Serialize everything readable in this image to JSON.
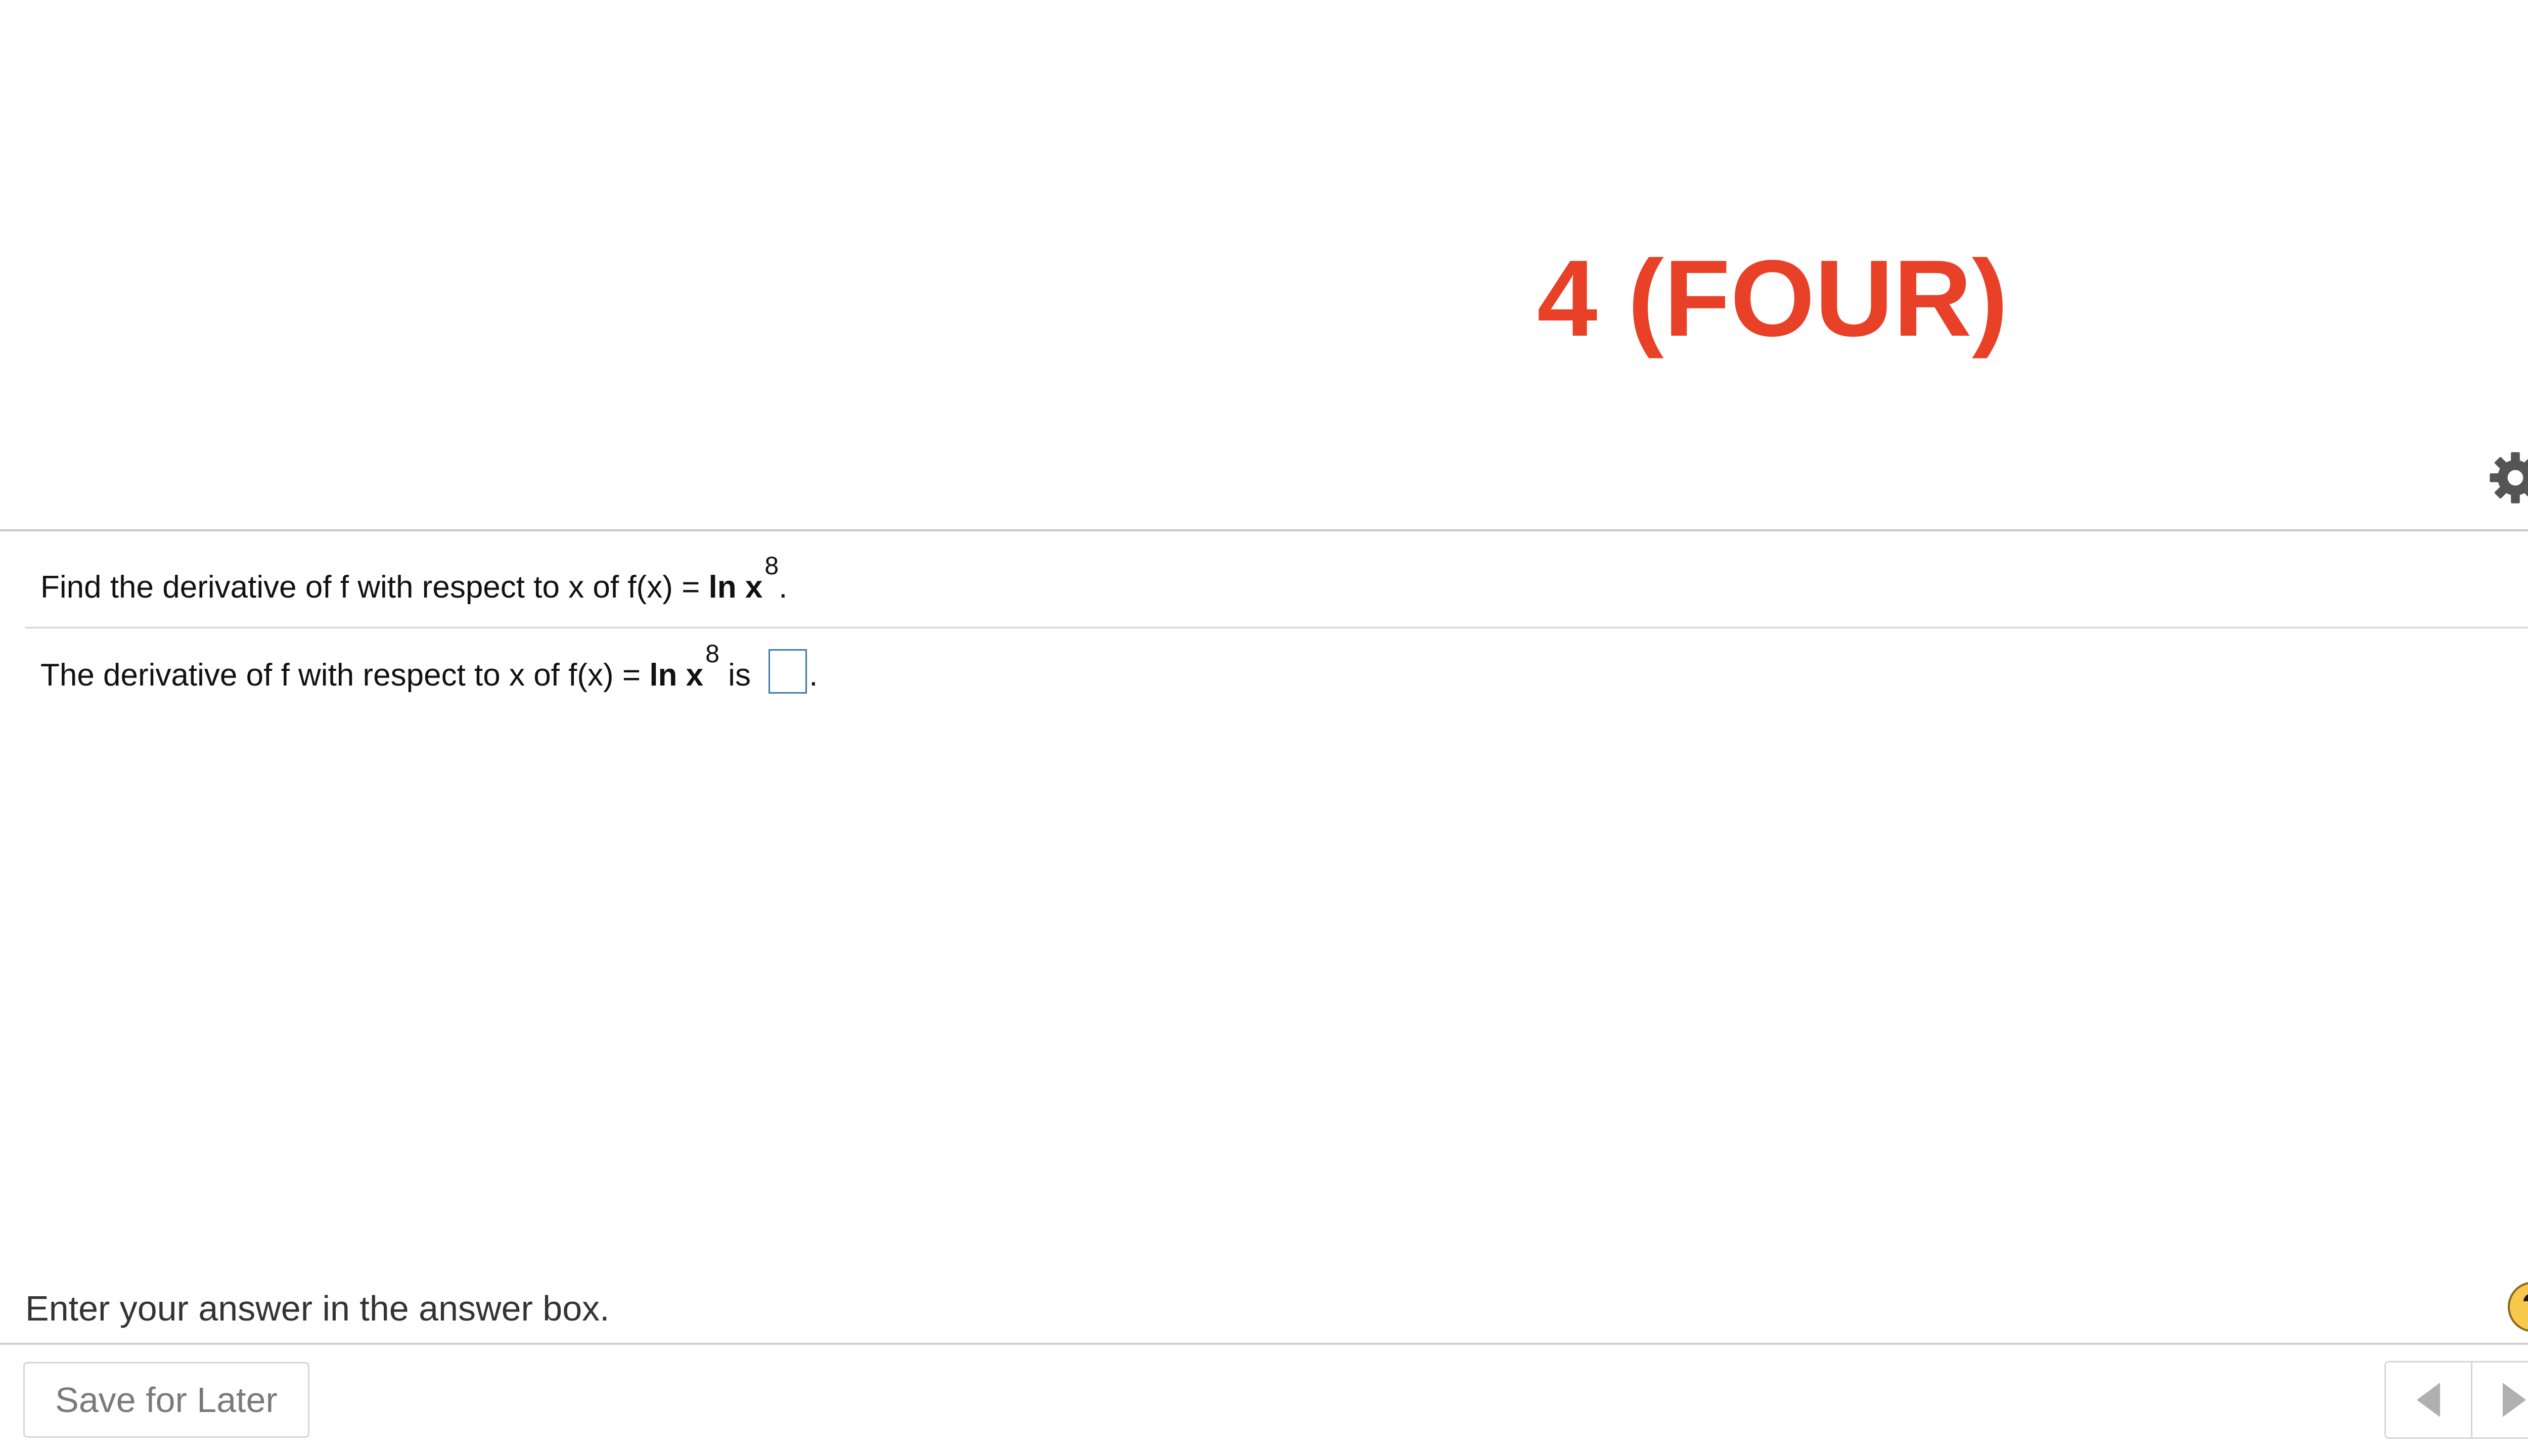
{
  "heading": "4 (FOUR)",
  "question": {
    "prefix": "Find the derivative of f with respect to x of f(x)",
    "equals": " = ",
    "function": "ln x",
    "exponent": "8",
    "suffix": "."
  },
  "answer": {
    "prefix": "The derivative of f with respect to x of f(x)",
    "equals": " = ",
    "function": "ln x",
    "exponent": "8",
    "connector": " is ",
    "value": "",
    "suffix": "."
  },
  "instruction": "Enter your answer in the answer box.",
  "help_label": "?",
  "save_label": "Save for Later",
  "icons": {
    "settings": "gear-icon",
    "help": "help-icon",
    "previous": "arrow-left-icon",
    "next": "arrow-right-icon"
  },
  "colors": {
    "heading": "#e84128",
    "answer_box_border": "#3a7ca5",
    "help_badge": "#f7c84b"
  }
}
